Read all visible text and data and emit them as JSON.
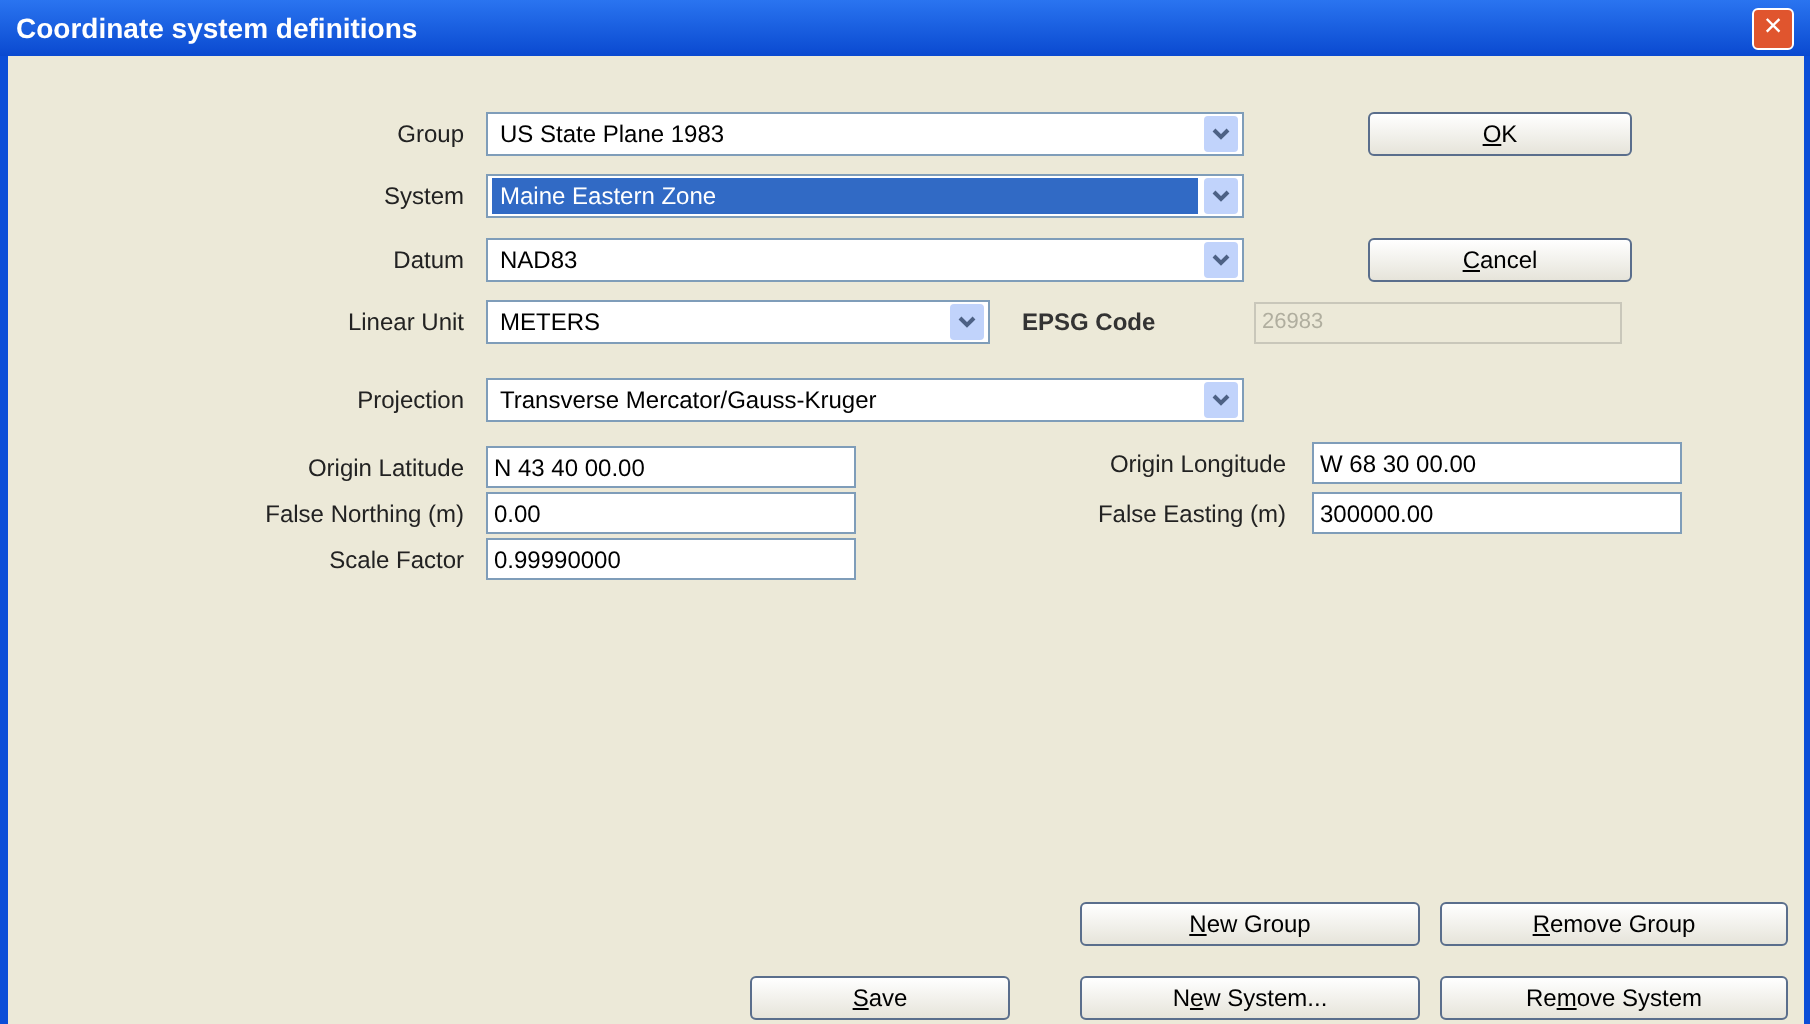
{
  "window": {
    "title": "Coordinate system definitions",
    "close": "×"
  },
  "combos": [
    {
      "label": "Group",
      "value": "US State Plane 1983",
      "highlighted": false
    },
    {
      "label": "System",
      "value": "Maine Eastern Zone",
      "highlighted": true
    },
    {
      "label": "Datum",
      "value": "NAD83",
      "highlighted": false
    }
  ],
  "linear_unit": {
    "label": "Linear Unit",
    "value": "METERS",
    "highlighted": false
  },
  "epsg": {
    "label": "EPSG Code",
    "value": "26983",
    "disabled": true
  },
  "projection": {
    "label": "Projection",
    "value": "Transverse Mercator/Gauss-Kruger",
    "highlighted": false
  },
  "params": [
    {
      "label": "Origin Latitude",
      "value": "N 43 40 00.00"
    },
    {
      "label": "False Northing (m)",
      "value": "0.00"
    },
    {
      "label": "Scale Factor",
      "value": "0.99990000"
    }
  ],
  "params_right": [
    {
      "label": "Origin Longitude",
      "value": "W 68 30 00.00"
    },
    {
      "label": "False Easting (m)",
      "value": "300000.00"
    }
  ],
  "buttons": {
    "ok": {
      "mnemonic": "O",
      "after": "K"
    },
    "cancel": {
      "mnemonic": "C",
      "after": "ancel"
    },
    "new_group": {
      "mnemonic": "N",
      "after": "ew Group"
    },
    "remove_group": {
      "mnemonic": "R",
      "after": "emove Group"
    },
    "save": {
      "mnemonic": "S",
      "after": "ave"
    },
    "new_system": {
      "before": "N",
      "mnemonic": "e",
      "after": "w System..."
    },
    "remove_system": {
      "before": "Re",
      "mnemonic": "m",
      "after": "ove System"
    }
  }
}
